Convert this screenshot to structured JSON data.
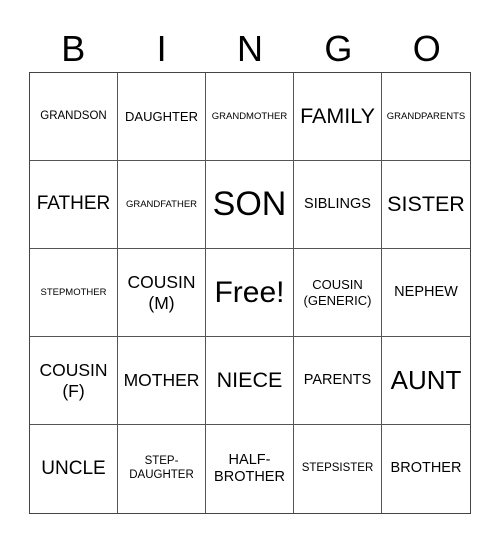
{
  "header": [
    "B",
    "I",
    "N",
    "G",
    "O"
  ],
  "cells": [
    "GRANDSON",
    "DAUGHTER",
    "GRANDMOTHER",
    "FAMILY",
    "GRANDPARENTS",
    "FATHER",
    "GRANDFATHER",
    "SON",
    "SIBLINGS",
    "SISTER",
    "STEPMOTHER",
    "COUSIN\n(M)",
    "Free!",
    "COUSIN\n(GENERIC)",
    "NEPHEW",
    "COUSIN\n(F)",
    "MOTHER",
    "NIECE",
    "PARENTS",
    "AUNT",
    "UNCLE",
    "STEP-\nDAUGHTER",
    "HALF-\nBROTHER",
    "STEPSISTER",
    "BROTHER"
  ]
}
